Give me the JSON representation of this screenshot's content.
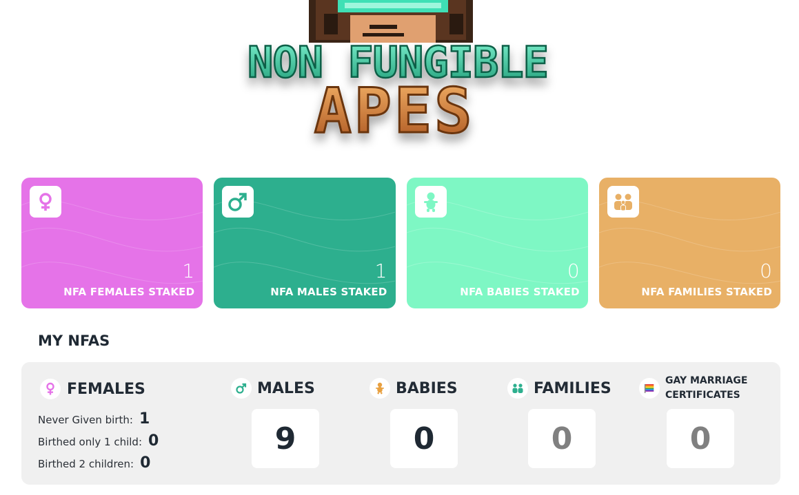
{
  "logo": {
    "line1": "NON FUNGIBLE",
    "line2": "APES"
  },
  "cards": [
    {
      "id": "females",
      "icon": "female-symbol-icon",
      "count": "1",
      "label": "NFA FEMALES STAKED",
      "color": "#e573e8"
    },
    {
      "id": "males",
      "icon": "male-symbol-icon",
      "count": "1",
      "label": "NFA MALES STAKED",
      "color": "#2daf8e"
    },
    {
      "id": "babies",
      "icon": "baby-icon",
      "count": "0",
      "label": "NFA BABIES STAKED",
      "color": "#7ef7c4"
    },
    {
      "id": "families",
      "icon": "family-icon",
      "count": "0",
      "label": "NFA FAMILIES STAKED",
      "color": "#e8b066"
    }
  ],
  "my_nfas": {
    "title": "MY NFAS",
    "females": {
      "heading": "FEMALES",
      "rows": [
        {
          "label": "Never Given birth:",
          "value": "1"
        },
        {
          "label": "Birthed only 1 child:",
          "value": "0"
        },
        {
          "label": "Birthed 2 children:",
          "value": "0"
        }
      ]
    },
    "males": {
      "heading": "MALES",
      "value": "9"
    },
    "babies": {
      "heading": "BABIES",
      "value": "0"
    },
    "families": {
      "heading": "FAMILIES",
      "value": "0"
    },
    "certificates": {
      "heading_line1": "GAY MARRIAGE",
      "heading_line2": "CERTIFICATES",
      "value": "0"
    }
  }
}
